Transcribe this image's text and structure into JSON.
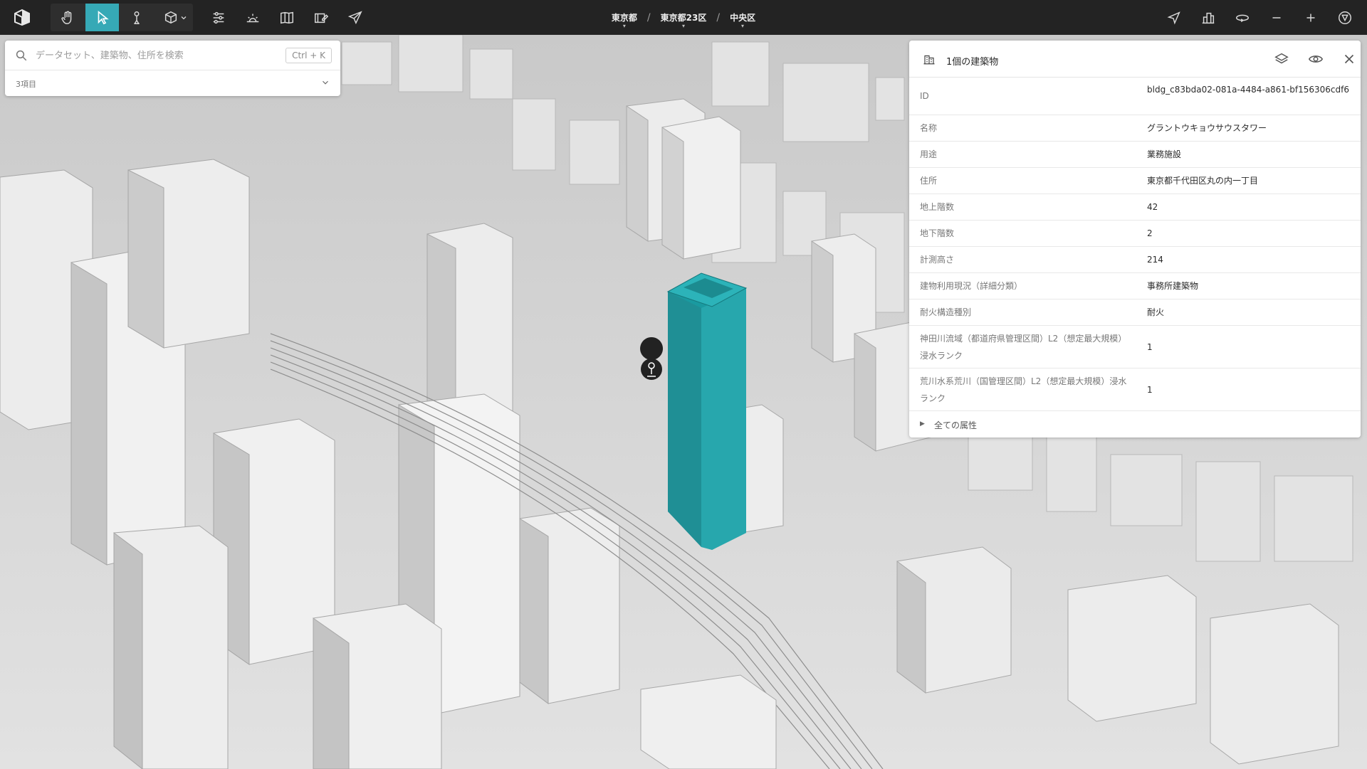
{
  "toolbar": {
    "tools": [
      "hand-tool",
      "select-tool",
      "pedestrian-tool",
      "3d-box-tool",
      "settings-sliders",
      "sun-horizon",
      "map-book",
      "edit-map",
      "share"
    ],
    "active_tool": "select-tool",
    "right_tools": [
      "navigation-arrow",
      "building-layer",
      "rotate-view",
      "zoom-out",
      "zoom-in",
      "compass"
    ],
    "accent": "#36a9b6"
  },
  "breadcrumb": {
    "items": [
      "東京都",
      "東京都23区",
      "中央区"
    ],
    "separator": "/"
  },
  "search": {
    "placeholder": "データセット、建築物、住所を検索",
    "value": "",
    "shortcut": "Ctrl + K",
    "count_label": "3項目"
  },
  "inspector": {
    "title": "1個の建築物",
    "attributes": [
      {
        "key": "ID",
        "value": "bldg_c83bda02-081a-4484-a861-bf156306cdf6"
      },
      {
        "key": "名称",
        "value": "グラントウキョウサウスタワー"
      },
      {
        "key": "用途",
        "value": "業務施設"
      },
      {
        "key": "住所",
        "value": "東京都千代田区丸の内一丁目"
      },
      {
        "key": "地上階数",
        "value": "42"
      },
      {
        "key": "地下階数",
        "value": "2"
      },
      {
        "key": "計測高さ",
        "value": "214"
      },
      {
        "key": "建物利用現況（詳細分類）",
        "value": "事務所建築物"
      },
      {
        "key": "耐火構造種別",
        "value": "耐火"
      },
      {
        "key": "神田川流域（都道府県管理区間）L2（想定最大規模）浸水ランク",
        "value": "1"
      },
      {
        "key": "荒川水系荒川（国管理区間）L2（想定最大規模）浸水ランク",
        "value": "1"
      }
    ],
    "all_attributes_label": "全ての属性",
    "highlight_color": "#1a9aa0"
  }
}
